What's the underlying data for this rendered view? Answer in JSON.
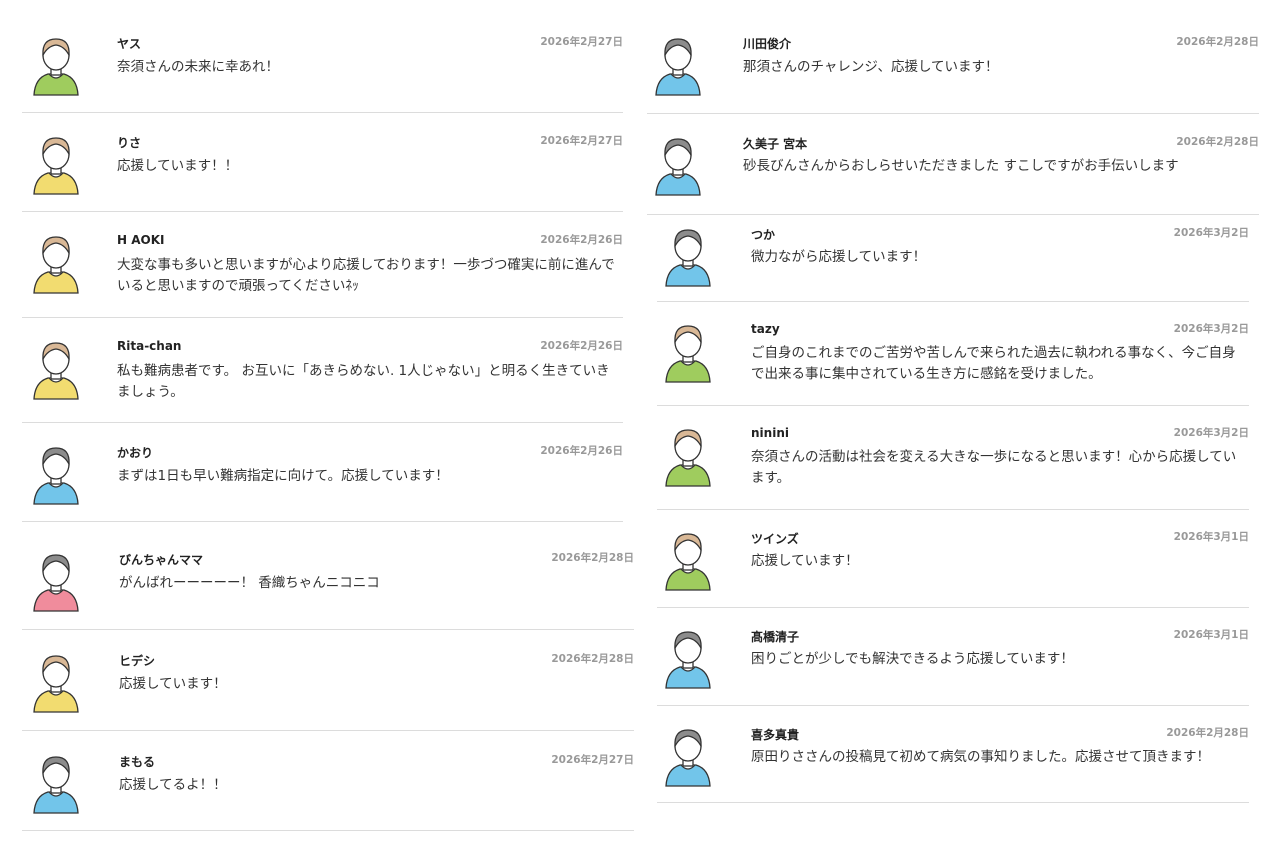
{
  "colors": {
    "green": "#9fcc5e",
    "yellow": "#f2dc70",
    "blue": "#72c5ea",
    "pink": "#f08c9c",
    "tan": "#d9b896",
    "gray": "#8c8c8c",
    "divider": "#dcdcdc",
    "date": "#999999"
  },
  "comments": [
    {
      "name": "ヤス",
      "date": "2026年2月27日",
      "message": "奈須さんの未来に幸あれ！",
      "avatar": {
        "hair": "tan",
        "shirt": "green"
      }
    },
    {
      "name": "りさ",
      "date": "2026年2月27日",
      "message": "応援しています！！",
      "avatar": {
        "hair": "tan",
        "shirt": "yellow"
      }
    },
    {
      "name": "H AOKI",
      "date": "2026年2月26日",
      "message": "大変な事も多いと思いますが心より応援しております！一歩づつ確実に前に進んでいると思いますので頑張ってくださいﾈｯ",
      "avatar": {
        "hair": "tan",
        "shirt": "yellow"
      }
    },
    {
      "name": "Rita-chan",
      "date": "2026年2月26日",
      "message": "私も難病患者です。 お互いに「あきらめない. 1人じゃない」と明るく生きていきましょう。",
      "avatar": {
        "hair": "tan",
        "shirt": "yellow"
      }
    },
    {
      "name": "かおり",
      "date": "2026年2月26日",
      "message": "まずは1日も早い難病指定に向けて。応援しています！",
      "avatar": {
        "hair": "gray",
        "shirt": "blue"
      }
    },
    {
      "name": "びんちゃんママ",
      "date": "2026年2月28日",
      "message": "がんばれーーーーー！ 香織ちゃんニコニコ",
      "avatar": {
        "hair": "gray",
        "shirt": "pink"
      }
    },
    {
      "name": "ヒデシ",
      "date": "2026年2月28日",
      "message": "応援しています！",
      "avatar": {
        "hair": "tan",
        "shirt": "yellow"
      }
    },
    {
      "name": "まもる",
      "date": "2026年2月27日",
      "message": "応援してるよ！！",
      "avatar": {
        "hair": "gray",
        "shirt": "blue"
      }
    },
    {
      "name": "川田俊介",
      "date": "2026年2月28日",
      "message": "那須さんのチャレンジ、応援しています！",
      "avatar": {
        "hair": "gray",
        "shirt": "blue"
      }
    },
    {
      "name": "久美子 宮本",
      "date": "2026年2月28日",
      "message": "砂長びんさんからおしらせいただきました すこしですがお手伝いします",
      "avatar": {
        "hair": "gray",
        "shirt": "blue"
      }
    },
    {
      "name": "つか",
      "date": "2026年3月2日",
      "message": "微力ながら応援しています！",
      "avatar": {
        "hair": "gray",
        "shirt": "blue"
      }
    },
    {
      "name": "tazy",
      "date": "2026年3月2日",
      "message": "ご自身のこれまでのご苦労や苦しんで来られた過去に執われる事なく、今ご自身で出来る事に集中されている生き方に感銘を受けました。",
      "avatar": {
        "hair": "tan",
        "shirt": "green"
      }
    },
    {
      "name": "ninini",
      "date": "2026年3月2日",
      "message": "奈須さんの活動は社会を変える大きな一歩になると思います！心から応援しています。",
      "avatar": {
        "hair": "tan",
        "shirt": "green"
      }
    },
    {
      "name": "ツインズ",
      "date": "2026年3月1日",
      "message": "応援しています！",
      "avatar": {
        "hair": "tan",
        "shirt": "green"
      }
    },
    {
      "name": "髙橋清子",
      "date": "2026年3月1日",
      "message": "困りごとが少しでも解決できるよう応援しています！",
      "avatar": {
        "hair": "gray",
        "shirt": "blue"
      }
    },
    {
      "name": "喜多真貴",
      "date": "2026年2月28日",
      "message": "原田りささんの投稿見て初めて病気の事知りました。応援させて頂きます！",
      "avatar": {
        "hair": "gray",
        "shirt": "blue"
      }
    }
  ]
}
